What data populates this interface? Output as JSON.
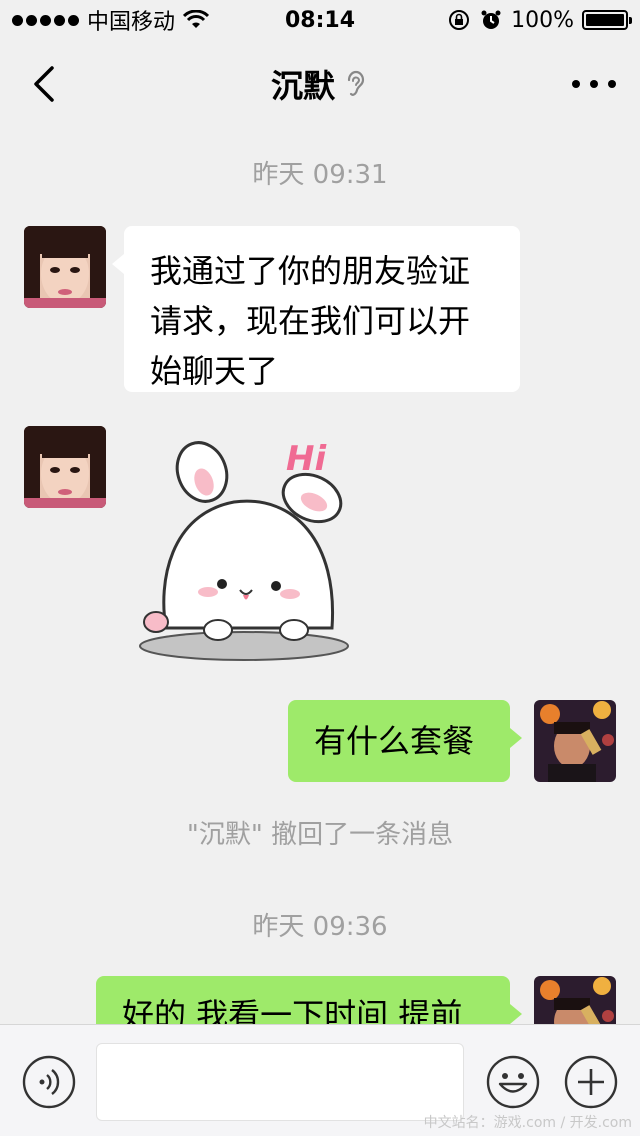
{
  "status_bar": {
    "carrier": "中国移动",
    "time": "08:14",
    "battery": "100%",
    "battery_level": 1.0
  },
  "nav": {
    "title": "沉默"
  },
  "messages": {
    "ts1": "昨天 09:31",
    "msg1": "我通过了你的朋友验证请求，现在我们可以开始聊天了",
    "sticker_text": "Hi",
    "msg3": "有什么套餐",
    "recall_note": "\"沉默\" 撤回了一条消息",
    "ts2": "昨天 09:36",
    "msg4": "好的 我看一下时间 提前"
  },
  "watermark": "中文站名：游戏.com / 开发.com",
  "colors": {
    "background": "#f0f0f0",
    "incoming_bubble": "#ffffff",
    "outgoing_bubble": "#9eea6a",
    "timestamp_text": "#a0a0a0"
  },
  "icons": [
    "back-icon",
    "ear-icon",
    "more-icon",
    "voice-icon",
    "emoji-icon",
    "plus-icon",
    "wifi-icon",
    "lock-rotation-icon",
    "alarm-icon",
    "battery-icon"
  ]
}
